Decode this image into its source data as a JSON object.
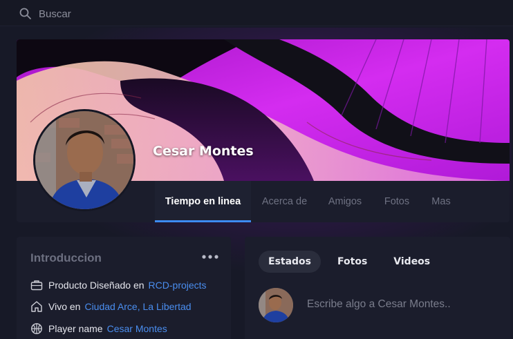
{
  "search": {
    "placeholder": "Buscar",
    "icon": "search-icon"
  },
  "profile": {
    "name": "Cesar Montes",
    "tabs": [
      {
        "label": "Tiempo en linea",
        "active": true
      },
      {
        "label": "Acerca de",
        "active": false
      },
      {
        "label": "Amigos",
        "active": false
      },
      {
        "label": "Fotos",
        "active": false
      },
      {
        "label": "Mas",
        "active": false
      }
    ]
  },
  "intro": {
    "title": "Introduccion",
    "rows": [
      {
        "icon": "briefcase-icon",
        "label": "Producto Diseñado en",
        "value": "RCD-projects"
      },
      {
        "icon": "home-icon",
        "label": "Vivo en",
        "value": "Ciudad Arce, La Libertad"
      },
      {
        "icon": "basketball-icon",
        "label": "Player name",
        "value": "Cesar Montes"
      }
    ]
  },
  "post": {
    "tabs": [
      {
        "label": "Estados",
        "active": true
      },
      {
        "label": "Fotos",
        "active": false
      },
      {
        "label": "Videos",
        "active": false
      }
    ],
    "placeholder": "Escribe algo a Cesar Montes.."
  },
  "colors": {
    "accent": "#3d8bf5",
    "link": "#4a8ef0",
    "background": "#171927",
    "card": "#1b1d2c",
    "cover_magenta": "#c51ee6"
  }
}
